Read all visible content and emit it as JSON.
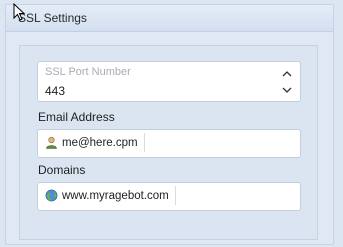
{
  "panel": {
    "title": "SSL Settings"
  },
  "ssl_port": {
    "label": "SSL Port Number",
    "value": "443"
  },
  "email": {
    "label": "Email Address",
    "value": "me@here.cpm",
    "icon": "user-icon"
  },
  "domains": {
    "label": "Domains",
    "value": "www.myragebot.com",
    "icon": "globe-icon"
  },
  "colors": {
    "background": "#dce6f2",
    "field_bg": "#ffffff",
    "border": "#c3cfdd"
  }
}
